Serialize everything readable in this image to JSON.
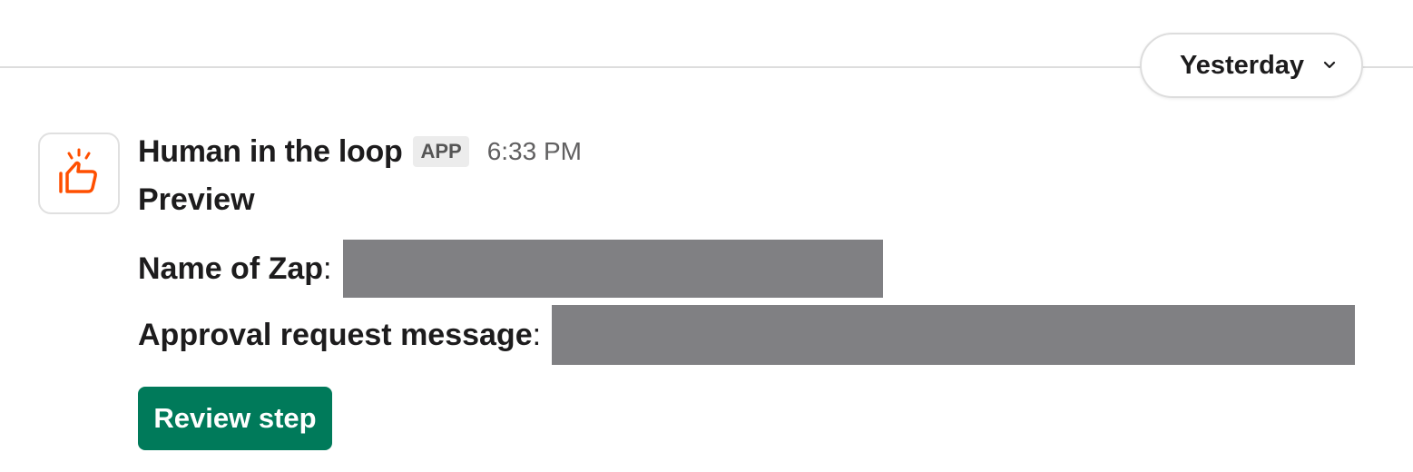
{
  "date_divider": {
    "label": "Yesterday"
  },
  "message": {
    "sender": "Human in the loop",
    "badge": "APP",
    "time": "6:33 PM",
    "avatar_icon": "thumbs-up-icon",
    "title": "Preview",
    "fields": [
      {
        "label": "Name of Zap",
        "separator": ":"
      },
      {
        "label": "Approval request message",
        "separator": ":"
      }
    ],
    "action_button": "Review step"
  },
  "colors": {
    "accent_button": "#007a5a",
    "icon_orange": "#ff4f00",
    "redaction": "#808083"
  }
}
